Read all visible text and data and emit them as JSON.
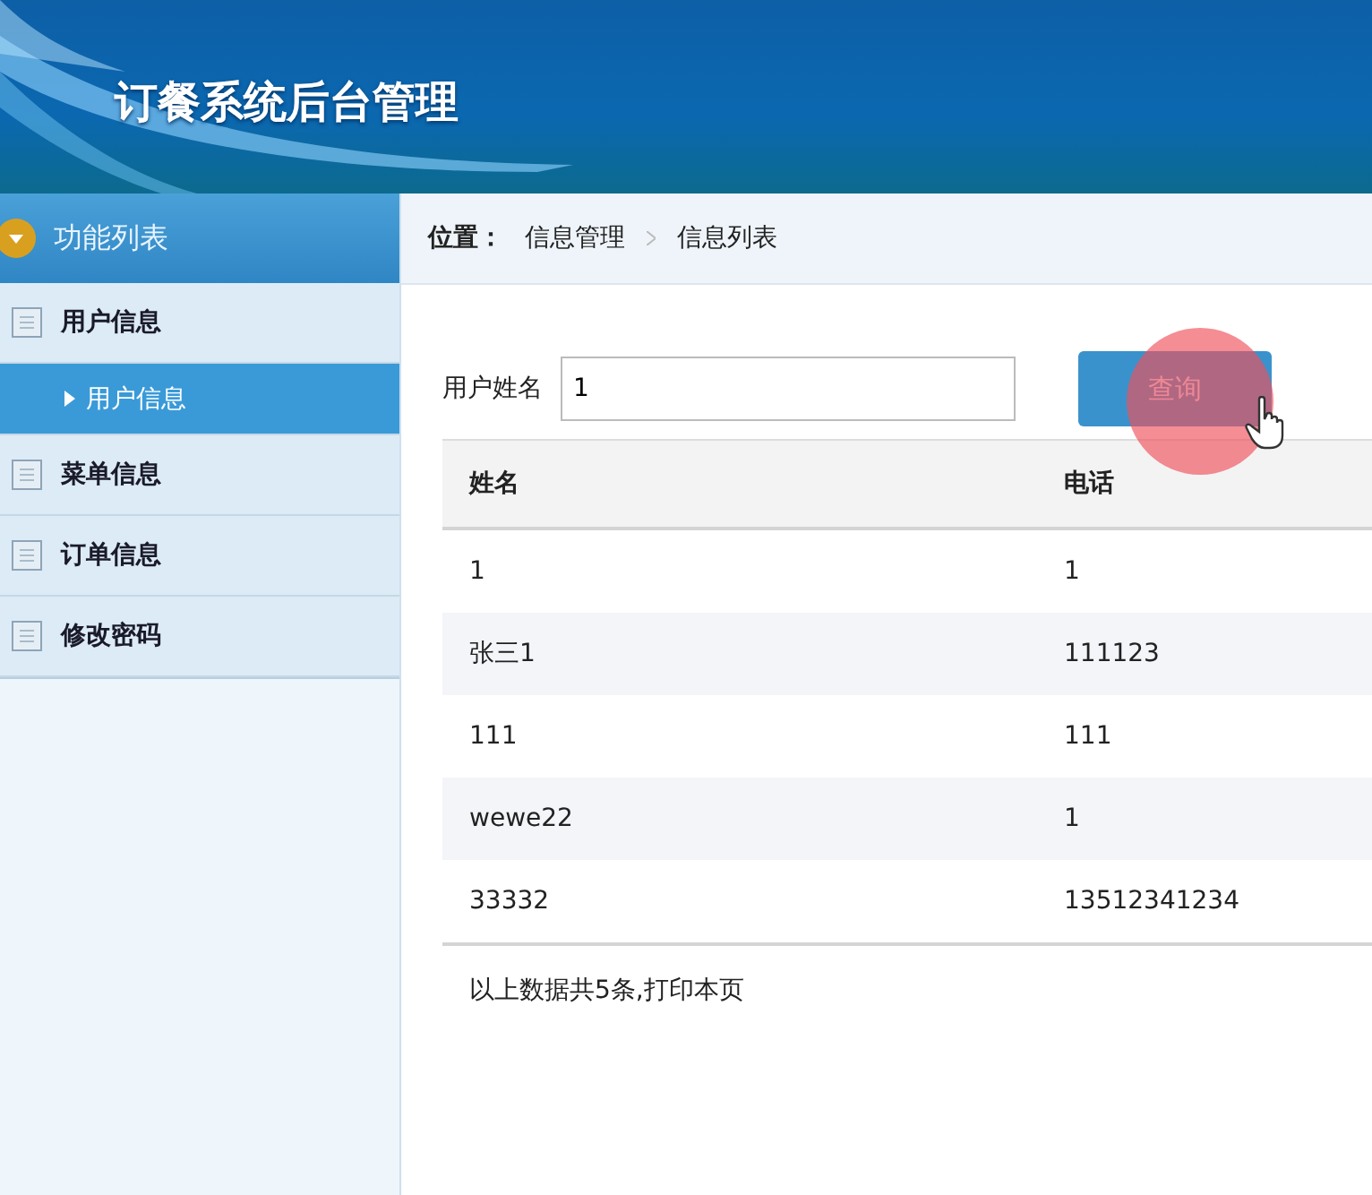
{
  "header": {
    "title": "订餐系统后台管理"
  },
  "sidebar": {
    "title": "功能列表",
    "items": [
      {
        "label": "用户信息",
        "selected": false,
        "children": [
          {
            "label": "用户信息",
            "selected": true
          }
        ]
      },
      {
        "label": "菜单信息",
        "selected": false
      },
      {
        "label": "订单信息",
        "selected": false
      },
      {
        "label": "修改密码",
        "selected": false
      }
    ]
  },
  "breadcrumb": {
    "label": "位置：",
    "items": [
      "信息管理",
      "信息列表"
    ]
  },
  "search": {
    "label": "用户姓名",
    "value": "1",
    "button": "查询"
  },
  "table": {
    "columns": [
      "姓名",
      "电话"
    ],
    "rows": [
      [
        "1",
        "1"
      ],
      [
        "张三1",
        "111123"
      ],
      [
        "111",
        "111"
      ],
      [
        "wewe22",
        "1"
      ],
      [
        "33332",
        "13512341234"
      ]
    ]
  },
  "footer": "以上数据共5条,打印本页"
}
